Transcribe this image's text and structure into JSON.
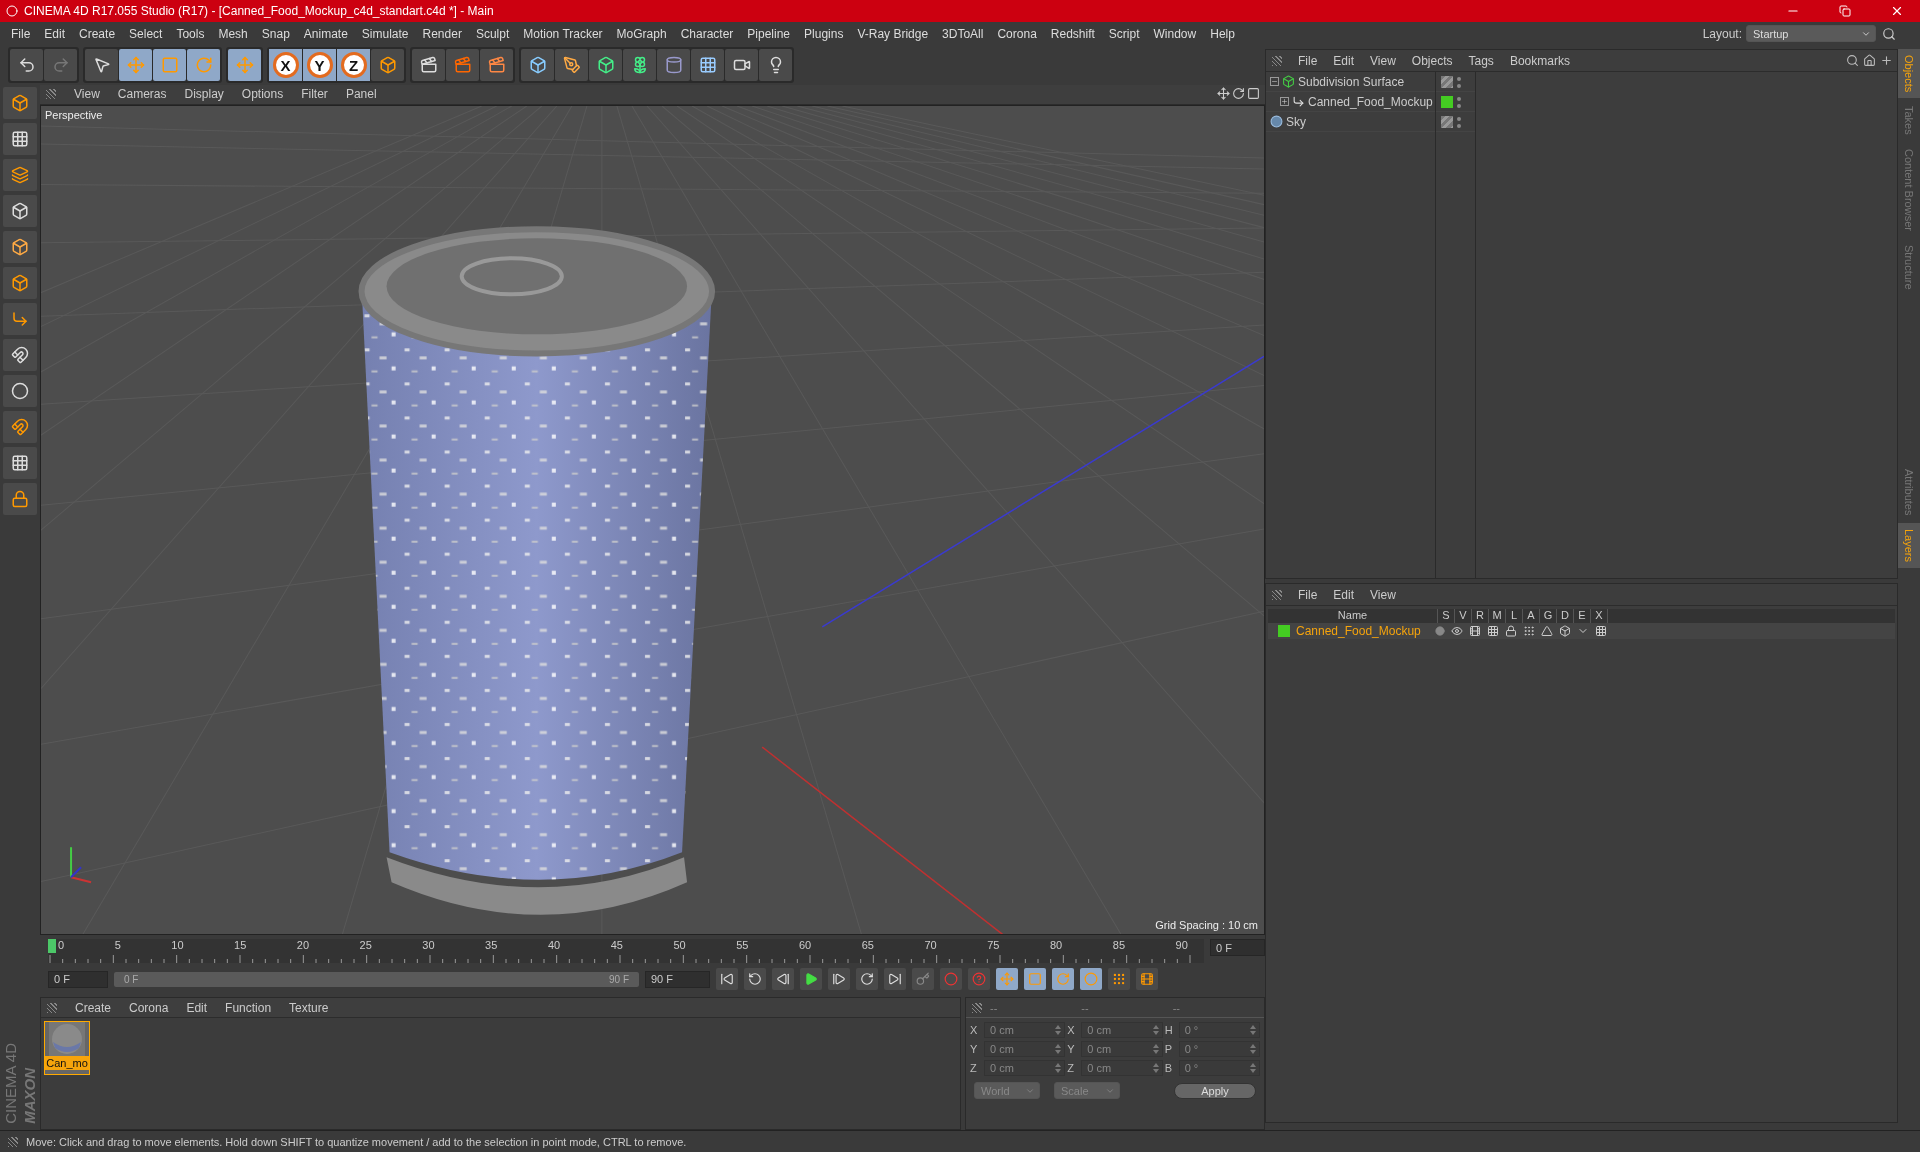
{
  "window": {
    "title": "CINEMA 4D R17.055 Studio (R17) - [Canned_Food_Mockup_c4d_standart.c4d *] - Main"
  },
  "menu": [
    "File",
    "Edit",
    "Create",
    "Select",
    "Tools",
    "Mesh",
    "Snap",
    "Animate",
    "Simulate",
    "Render",
    "Sculpt",
    "Motion Tracker",
    "MoGraph",
    "Character",
    "Pipeline",
    "Plugins",
    "V-Ray Bridge",
    "3DToAll",
    "Corona",
    "Redshift",
    "Script",
    "Window",
    "Help"
  ],
  "layout": {
    "label": "Layout:",
    "value": "Startup"
  },
  "toolbar": {
    "axis_buttons": [
      "X",
      "Y",
      "Z"
    ]
  },
  "viewport": {
    "menu": [
      "View",
      "Cameras",
      "Display",
      "Options",
      "Filter",
      "Panel"
    ],
    "camera": "Perspective",
    "grid_spacing": "Grid Spacing : 10 cm"
  },
  "timeline": {
    "ticks": [
      "0",
      "5",
      "10",
      "15",
      "20",
      "25",
      "30",
      "35",
      "40",
      "45",
      "50",
      "55",
      "60",
      "65",
      "70",
      "75",
      "80",
      "85",
      "90"
    ],
    "current_frame": "0 F",
    "start_field": "0 F",
    "range_start": "0 F",
    "range_end": "90 F",
    "level": 1,
    "end_field": "90 F"
  },
  "material_manager": {
    "menu": [
      "Create",
      "Corona",
      "Edit",
      "Function",
      "Texture"
    ],
    "materials": [
      {
        "name": "Can_mo",
        "selected": true
      }
    ]
  },
  "coordinates": {
    "headers": [
      "--",
      "--",
      "--"
    ],
    "rows": [
      {
        "axis": "X",
        "position": "0 cm",
        "size_axis": "X",
        "size": "0 cm",
        "rot_axis": "H",
        "rotation": "0 °"
      },
      {
        "axis": "Y",
        "position": "0 cm",
        "size_axis": "Y",
        "size": "0 cm",
        "rot_axis": "P",
        "rotation": "0 °"
      },
      {
        "axis": "Z",
        "position": "0 cm",
        "size_axis": "Z",
        "size": "0 cm",
        "rot_axis": "B",
        "rotation": "0 °"
      }
    ],
    "mode": "World",
    "size_mode": "Scale",
    "apply": "Apply"
  },
  "object_manager": {
    "menu": [
      "File",
      "Edit",
      "View",
      "Objects",
      "Tags",
      "Bookmarks"
    ],
    "objects": [
      {
        "name": "Subdivision Surface",
        "kind": "subdivision",
        "expanded": true,
        "children": [
          {
            "name": "Canned_Food_Mockup",
            "kind": "null",
            "expanded": false,
            "color": "#44cc22"
          }
        ]
      },
      {
        "name": "Sky",
        "kind": "sky"
      }
    ]
  },
  "layer_manager": {
    "menu": [
      "File",
      "Edit",
      "View"
    ],
    "columns": [
      "Name",
      "S",
      "V",
      "R",
      "M",
      "L",
      "A",
      "G",
      "D",
      "E",
      "X"
    ],
    "layers": [
      {
        "name": "Canned_Food_Mockup",
        "color": "#44cc22"
      }
    ]
  },
  "side_tabs_top": [
    {
      "label": "Objects",
      "selected": true
    },
    {
      "label": "Takes",
      "selected": false
    },
    {
      "label": "Content Browser",
      "selected": false
    },
    {
      "label": "Structure",
      "selected": false
    }
  ],
  "side_tabs_bottom": [
    {
      "label": "Attributes",
      "selected": false
    },
    {
      "label": "Layers",
      "selected": true
    }
  ],
  "brand": {
    "maker": "MAXON",
    "product": "CINEMA 4D"
  },
  "status_bar": "Move: Click and drag to move elements. Hold down SHIFT to quantize movement / add to the selection in point mode, CTRL to remove."
}
